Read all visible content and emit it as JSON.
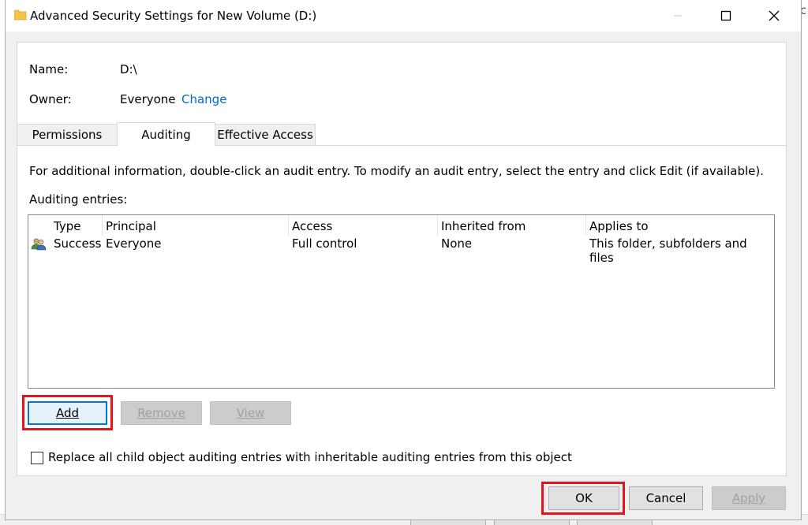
{
  "background": {
    "edge_text": "rc"
  },
  "titlebar": {
    "title": "Advanced Security Settings for New Volume (D:)",
    "icon": "folder-icon",
    "controls": [
      "minimize-icon",
      "maximize-icon",
      "close-icon"
    ]
  },
  "object": {
    "name_label": "Name:",
    "name_value": "D:\\",
    "owner_label": "Owner:",
    "owner_value": "Everyone",
    "change_link": "Change"
  },
  "tabs": [
    {
      "label": "Permissions",
      "selected": false
    },
    {
      "label": "Auditing",
      "selected": true
    },
    {
      "label": "Effective Access",
      "selected": false
    }
  ],
  "auditing": {
    "info_text": "For additional information, double-click an audit entry. To modify an audit entry, select the entry and click Edit (if available).",
    "entries_label": "Auditing entries:",
    "columns": [
      "Type",
      "Principal",
      "Access",
      "Inherited from",
      "Applies to"
    ],
    "rows": [
      {
        "icon": "users-icon",
        "type": "Success",
        "principal": "Everyone",
        "access": "Full control",
        "inherited_from": "None",
        "applies_to": "This folder, subfolders and files"
      }
    ],
    "add_label": "Add",
    "remove_label": "Remove",
    "view_label": "View",
    "replace_checkbox_label": "Replace all child object auditing entries with inheritable auditing entries from this object",
    "replace_checked": false
  },
  "footer": {
    "ok_label": "OK",
    "cancel_label": "Cancel",
    "apply_label": "Apply"
  },
  "colors": {
    "highlight_box": "#e0161e",
    "link": "#0066cc",
    "focus_border": "#0078d7"
  }
}
